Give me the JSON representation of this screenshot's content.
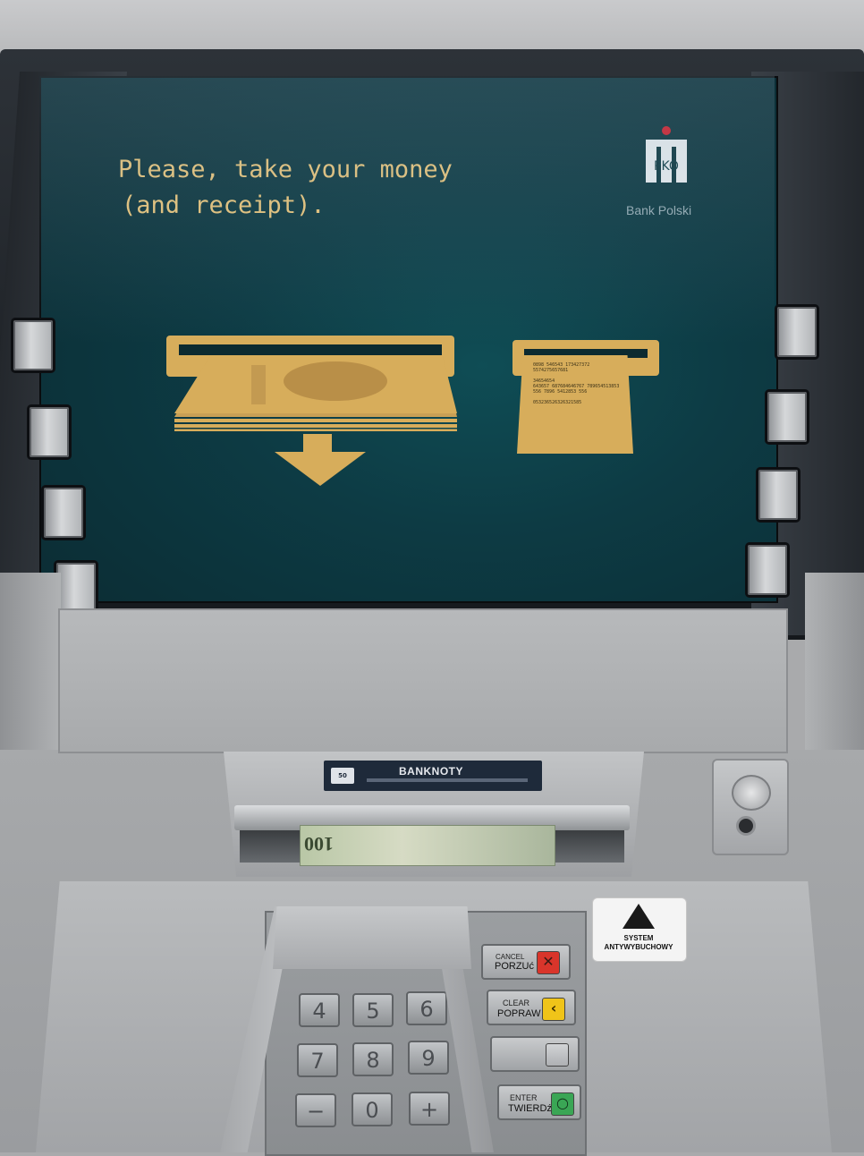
{
  "screen": {
    "message_line1": "Please, take your money",
    "message_line2": "(and receipt).",
    "bank_name": "Bank Polski",
    "logo_letters": "PKO",
    "accent_color": "#d7ad5b",
    "background_color": "#0d3b44"
  },
  "receipt": {
    "lines": [
      "0898 546543 173427372",
      "5574275657681",
      "",
      "34654654",
      "643657 687684646767 789654513853",
      "556 7896 5412853 556",
      "",
      "053236526326321585"
    ]
  },
  "dispenser": {
    "label": "BANKNOTY",
    "icon_text": "50",
    "banknote_value": "100"
  },
  "sticker": {
    "line1": "SYSTEM",
    "line2": "ANTYWYBUCHOWY"
  },
  "keypad": {
    "keys": [
      "4",
      "5",
      "6",
      "7",
      "8",
      "9",
      "−",
      "0",
      "+"
    ],
    "cancel_en": "CANCEL",
    "cancel_pl": "PORZUć",
    "clear_en": "CLEAR",
    "clear_pl": "POPRAW",
    "enter_en": "ENTER",
    "enter_pl": "TWIERDź",
    "cancel_symbol": "✕",
    "clear_symbol": "‹",
    "enter_symbol": "○",
    "cancel_color": "#d9352b",
    "clear_color": "#f0c419",
    "enter_color": "#3aa655"
  }
}
